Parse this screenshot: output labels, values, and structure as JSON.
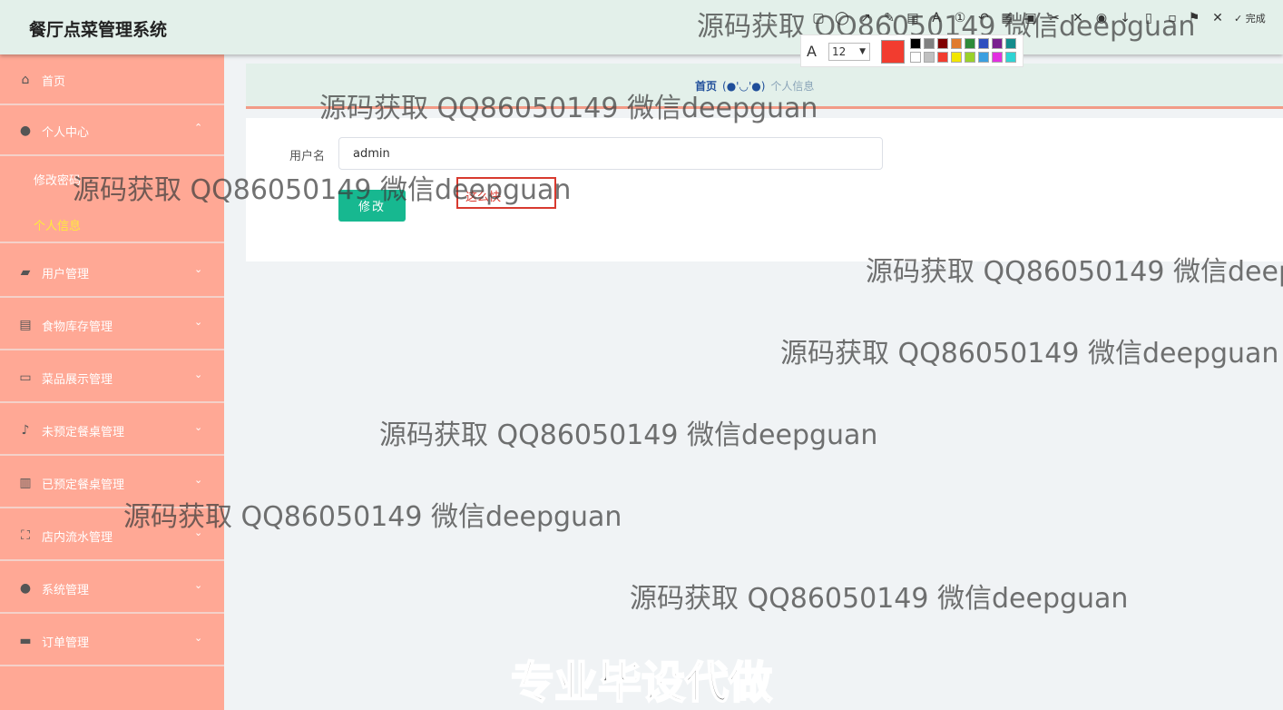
{
  "header": {
    "app_title": "餐厅点菜管理系统"
  },
  "sidebar": {
    "items": [
      {
        "label": "首页",
        "icon": "home-icon",
        "glyph": "⌂",
        "expandable": false
      },
      {
        "label": "个人中心",
        "icon": "user-icon",
        "glyph": "●",
        "expandable": true,
        "expanded": true
      },
      {
        "label": "用户管理",
        "icon": "wallet-icon",
        "glyph": "▰",
        "expandable": true
      },
      {
        "label": "食物库存管理",
        "icon": "briefcase-icon",
        "glyph": "▤",
        "expandable": true
      },
      {
        "label": "菜品展示管理",
        "icon": "chat-icon",
        "glyph": "▭",
        "expandable": true
      },
      {
        "label": "未预定餐桌管理",
        "icon": "microphone-icon",
        "glyph": "♪",
        "expandable": true
      },
      {
        "label": "已预定餐桌管理",
        "icon": "clipboard-icon",
        "glyph": "▥",
        "expandable": true
      },
      {
        "label": "店内流水管理",
        "icon": "scan-icon",
        "glyph": "⛶",
        "expandable": true
      },
      {
        "label": "系统管理",
        "icon": "user-icon",
        "glyph": "●",
        "expandable": true
      },
      {
        "label": "订单管理",
        "icon": "monitor-icon",
        "glyph": "▬",
        "expandable": true
      }
    ],
    "submenu": [
      {
        "label": "修改密码",
        "active": false
      },
      {
        "label": "个人信息",
        "active": true
      }
    ],
    "arrow_down": "⌄",
    "arrow_up": "⌃"
  },
  "breadcrumb": {
    "home": "首页",
    "face": "(●'◡'●)",
    "current": "个人信息"
  },
  "form": {
    "username_label": "用户名",
    "username_value": "admin",
    "submit_label": "修改"
  },
  "annotation": {
    "text": "这么快"
  },
  "snip_tool": {
    "font_size": "12",
    "done_label": "完成",
    "current_color": "#f23c2f",
    "palette_top": [
      "#000000",
      "#808080",
      "#800000",
      "#e07a2e",
      "#2e8b3a",
      "#2f4fbf",
      "#7a1f8f",
      "#148c8c"
    ],
    "palette_bottom": [
      "#ffffff",
      "#c0c0c0",
      "#f23c2f",
      "#f2e600",
      "#9ad12a",
      "#3b9fe0",
      "#e22fe0",
      "#2fd4d4"
    ]
  },
  "watermark": {
    "text": "源码获取 QQ86050149 微信deepguan"
  },
  "promo": {
    "text": "专业毕设代做"
  }
}
